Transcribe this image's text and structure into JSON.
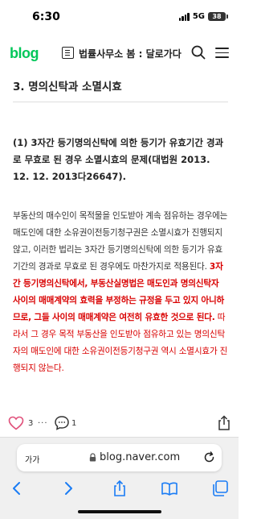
{
  "status_bar": {
    "time": "6:30",
    "network": "5G",
    "battery": "38"
  },
  "header": {
    "logo": "blog",
    "blog_title": "법률사무소 봄 : 달로가다"
  },
  "article": {
    "section_heading": "3. 명의신탁과 소멸시효",
    "subheading": "(1) 3자간 등기명의신탁에 의한 등기가 유효기간 경과로 무효로 된 경우 소멸시효의 문제(대법원 2013. 12. 12. 2013다26647).",
    "para_part1": "부동산의 매수인이 목적물을 인도받아 계속 점유하는 경우에는 매도인에 대한 소유권이전등기청구권은 소멸시효가 진행되지 않고, 이러한 법리는 3자간 등기명의신탁에 의한 등기가 유효기간의 경과로 무효로 된 경우에도 마찬가지로 적용된다. ",
    "para_part2_bold_red": "3자간 등기명의신탁에서, 부동산실명법은 매도인과 명의신탁자 사이의 매매계약의 효력을 부정하는 규정을 두고 있지 아니하므로, 그들 사이의 매매계약은 여전히 유효한 것으로 된다.",
    "para_part3_red": " 따라서 그 경우 목적 부동산을 인도받아 점유하고 있는 명의신탁자의 매도인에 대한 소유권이전등기청구권 역시 소멸시효가 진행되지 않는다."
  },
  "actions": {
    "like_count": "3",
    "more": "···",
    "comment_count": "1"
  },
  "browser": {
    "text_size_label": "가가",
    "url": "blog.naver.com"
  },
  "colors": {
    "brand_green": "#03c75a",
    "highlight_red": "#d90000",
    "safari_blue": "#1a7cf5"
  }
}
